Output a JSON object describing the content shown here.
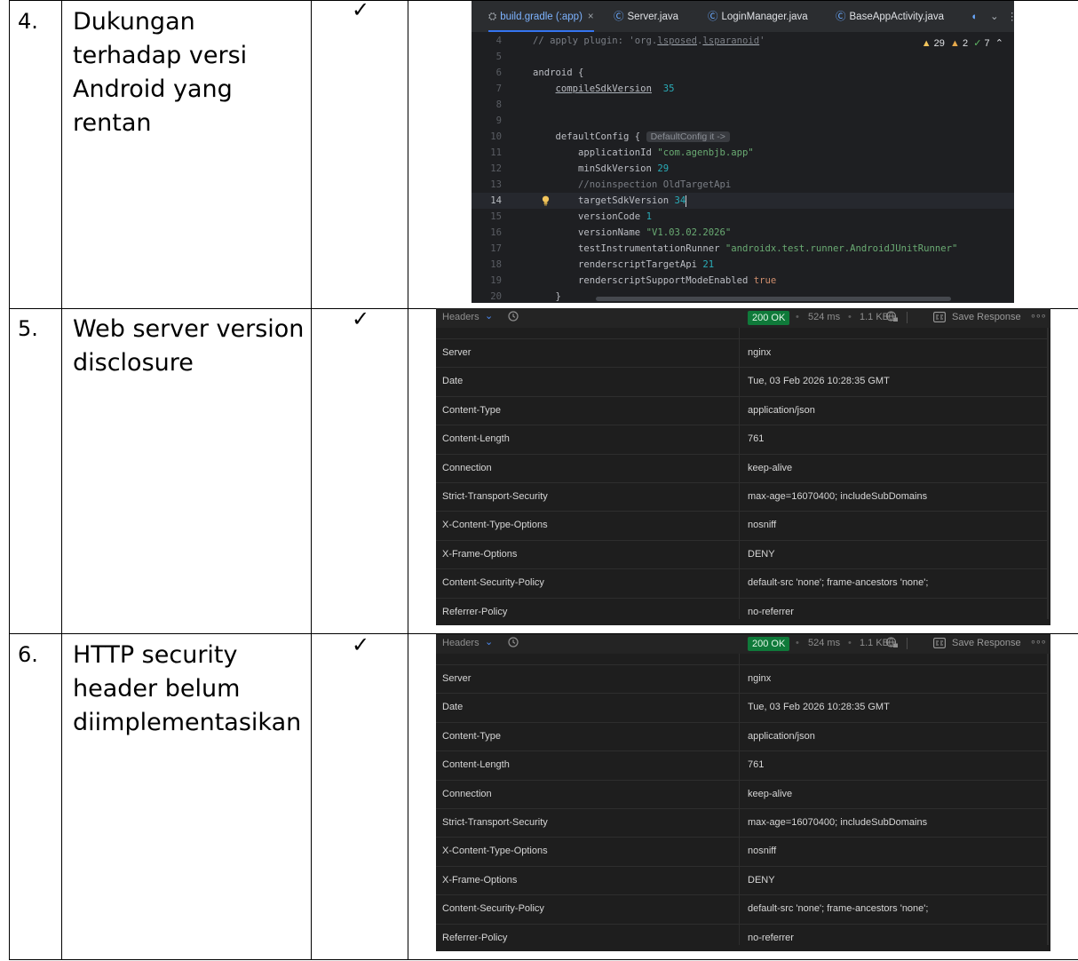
{
  "rows": [
    {
      "number": "4.",
      "title": "Dukungan terhadap versi Android yang rentan",
      "check": "✓"
    },
    {
      "number": "5.",
      "title": "Web server version disclosure",
      "check": "✓"
    },
    {
      "number": "6.",
      "title": "HTTP security header belum diimplementasikan",
      "check": "✓"
    }
  ],
  "ide": {
    "tabs": [
      "build.gradle (:app)",
      "Server.java",
      "LoginManager.java",
      "BaseAppActivity.java"
    ],
    "inspections": {
      "warnings": "29",
      "weak_warnings": "2",
      "ok": "7"
    },
    "lines": [
      {
        "n": "4",
        "segs": [
          [
            "c-cmt",
            "// apply plugin: 'org."
          ],
          [
            "c-cmt c-ul",
            "lsposed"
          ],
          [
            "c-cmt",
            "."
          ],
          [
            "c-cmt c-ul",
            "lsparanoid"
          ],
          [
            "c-cmt",
            "'"
          ]
        ]
      },
      {
        "n": "5",
        "segs": []
      },
      {
        "n": "6",
        "segs": [
          [
            "",
            "android {"
          ]
        ]
      },
      {
        "n": "7",
        "segs": [
          [
            "",
            "    "
          ],
          [
            "c-ul",
            "compileSdkVersion"
          ],
          [
            "",
            "  "
          ],
          [
            "c-num",
            "35"
          ]
        ]
      },
      {
        "n": "8",
        "segs": []
      },
      {
        "n": "9",
        "segs": []
      },
      {
        "n": "10",
        "segs": [
          [
            "",
            "    defaultConfig { "
          ],
          [
            "hint",
            "DefaultConfig it ->"
          ]
        ]
      },
      {
        "n": "11",
        "segs": [
          [
            "",
            "        applicationId "
          ],
          [
            "c-str",
            "\"com.agenbjb.app\""
          ]
        ]
      },
      {
        "n": "12",
        "segs": [
          [
            "",
            "        minSdkVersion "
          ],
          [
            "c-num",
            "29"
          ]
        ]
      },
      {
        "n": "13",
        "segs": [
          [
            "c-cmt",
            "        //noinspection OldTargetApi"
          ]
        ]
      },
      {
        "n": "14",
        "segs": [
          [
            "",
            "        targetSdkVersion "
          ],
          [
            "c-num",
            "34"
          ]
        ],
        "current": true
      },
      {
        "n": "15",
        "segs": [
          [
            "",
            "        versionCode "
          ],
          [
            "c-num",
            "1"
          ]
        ]
      },
      {
        "n": "16",
        "segs": [
          [
            "",
            "        versionName "
          ],
          [
            "c-str",
            "\"V1.03.02.2026\""
          ]
        ]
      },
      {
        "n": "17",
        "segs": [
          [
            "",
            "        testInstrumentationRunner "
          ],
          [
            "c-str",
            "\"androidx.test.runner.AndroidJUnitRunner\""
          ]
        ]
      },
      {
        "n": "18",
        "segs": [
          [
            "",
            "        renderscriptTargetApi "
          ],
          [
            "c-num",
            "21"
          ]
        ]
      },
      {
        "n": "19",
        "segs": [
          [
            "",
            "        renderscriptSupportModeEnabled "
          ],
          [
            "c-kw",
            "true"
          ]
        ]
      },
      {
        "n": "20",
        "segs": [
          [
            "",
            "    }"
          ]
        ]
      }
    ]
  },
  "http_panel": {
    "title": "Headers",
    "status": "200 OK",
    "time": "524 ms",
    "size": "1.1 KB",
    "save_label": "Save Response",
    "headers": [
      [
        "Server",
        "nginx"
      ],
      [
        "Date",
        "Tue, 03 Feb 2026 10:28:35 GMT"
      ],
      [
        "Content-Type",
        "application/json"
      ],
      [
        "Content-Length",
        "761"
      ],
      [
        "Connection",
        "keep-alive"
      ],
      [
        "Strict-Transport-Security",
        "max-age=16070400; includeSubDomains"
      ],
      [
        "X-Content-Type-Options",
        "nosniff"
      ],
      [
        "X-Frame-Options",
        "DENY"
      ],
      [
        "Content-Security-Policy",
        "default-src 'none'; frame-ancestors 'none';"
      ],
      [
        "Referrer-Policy",
        "no-referrer"
      ]
    ]
  },
  "colors": {
    "status_ok": "#0f7a3a",
    "ide_bg": "#1e1f22",
    "panel_bg": "#1e1e1e"
  }
}
